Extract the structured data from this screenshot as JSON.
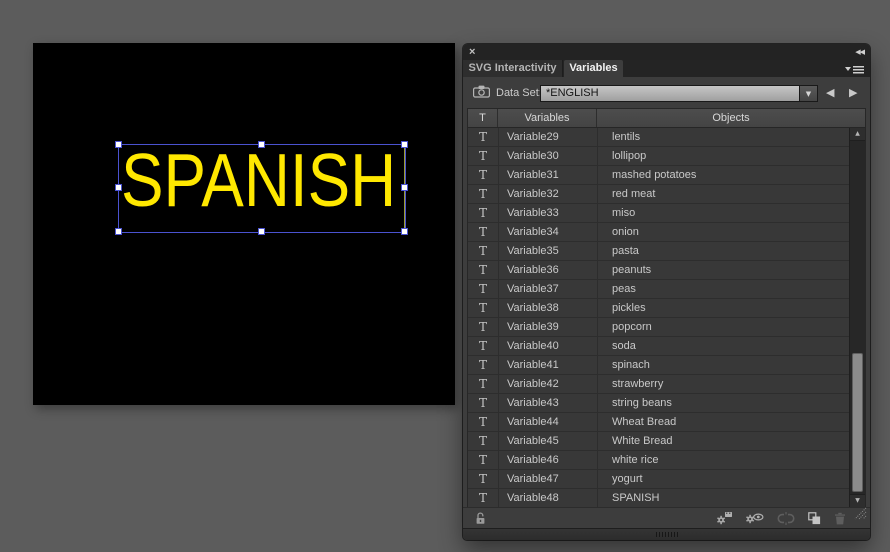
{
  "colors": {
    "background": "#5c5c5c",
    "artboard": "#000000",
    "text_yellow": "#ffe800",
    "selection_blue": "#4a52d0",
    "panel_body": "#3d3d3d"
  },
  "artboard": {
    "text": "SPANISH"
  },
  "panel": {
    "tabs": [
      {
        "label": "SVG Interactivity",
        "active": false
      },
      {
        "label": "Variables",
        "active": true
      }
    ],
    "dataset": {
      "label": "Data Set:",
      "value": "*ENGLISH"
    },
    "table": {
      "headers": {
        "type": "T",
        "variables": "Variables",
        "objects": "Objects"
      },
      "rows": [
        {
          "type": "T",
          "variable": "Variable29",
          "object": "lentils"
        },
        {
          "type": "T",
          "variable": "Variable30",
          "object": "lollipop"
        },
        {
          "type": "T",
          "variable": "Variable31",
          "object": "mashed potatoes"
        },
        {
          "type": "T",
          "variable": "Variable32",
          "object": "red meat"
        },
        {
          "type": "T",
          "variable": "Variable33",
          "object": "miso"
        },
        {
          "type": "T",
          "variable": "Variable34",
          "object": "onion"
        },
        {
          "type": "T",
          "variable": "Variable35",
          "object": "pasta"
        },
        {
          "type": "T",
          "variable": "Variable36",
          "object": "peanuts"
        },
        {
          "type": "T",
          "variable": "Variable37",
          "object": "peas"
        },
        {
          "type": "T",
          "variable": "Variable38",
          "object": "pickles"
        },
        {
          "type": "T",
          "variable": "Variable39",
          "object": "popcorn"
        },
        {
          "type": "T",
          "variable": "Variable40",
          "object": "soda"
        },
        {
          "type": "T",
          "variable": "Variable41",
          "object": "spinach"
        },
        {
          "type": "T",
          "variable": "Variable42",
          "object": "strawberry"
        },
        {
          "type": "T",
          "variable": "Variable43",
          "object": "string beans"
        },
        {
          "type": "T",
          "variable": "Variable44",
          "object": "Wheat Bread"
        },
        {
          "type": "T",
          "variable": "Variable45",
          "object": "White Bread"
        },
        {
          "type": "T",
          "variable": "Variable46",
          "object": "white rice"
        },
        {
          "type": "T",
          "variable": "Variable47",
          "object": "yogurt"
        },
        {
          "type": "T",
          "variable": "Variable48",
          "object": "SPANISH"
        }
      ]
    },
    "icons": {
      "close": "×",
      "collapse": "◀◀",
      "dropdown_arrow": "▼",
      "prev": "◀",
      "next": "▶",
      "scroll_up": "▲",
      "scroll_down": "▼"
    }
  }
}
